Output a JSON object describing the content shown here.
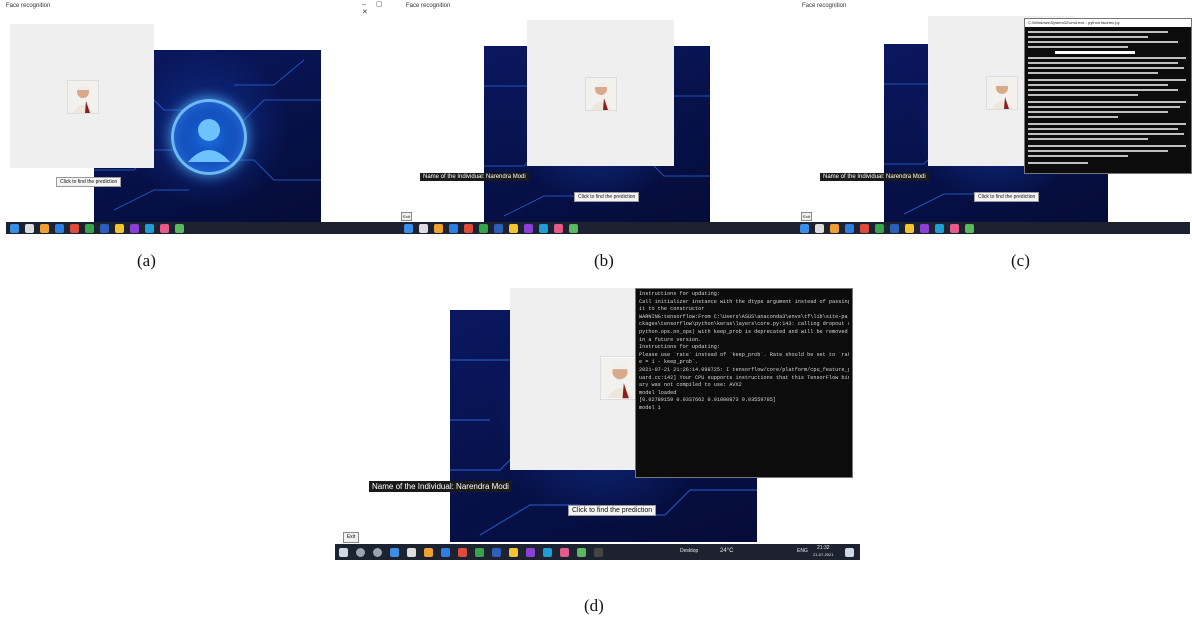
{
  "panels": {
    "a": {
      "caption": "(a)",
      "title": "Face recognition",
      "predict_button": "Click to find the prediction"
    },
    "b": {
      "caption": "(b)",
      "title": "Face recognition",
      "name_label": "Name of the Individual: Narendra Modi",
      "predict_button": "Click to find the prediction",
      "exit_button": "Exit"
    },
    "c": {
      "caption": "(c)",
      "title": "Face recognition",
      "name_label": "Name of the Individual: Narendra Modi",
      "predict_button": "Click to find the prediction",
      "exit_button": "Exit",
      "console_title": "C:\\Windows\\System32\\cmd.exe - python  facerec.py"
    },
    "d": {
      "caption": "(d)",
      "name_label": "Name of the Individual: Narendra Modi",
      "predict_button": "Click to find the prediction",
      "exit_button": "Exit",
      "console_lines": [
        "Instructions for updating:",
        "Call initializer instance with the dtype argument instead of passing",
        " it to the constructor",
        "WARNING:tensorflow:From C:\\Users\\ASUS\\anaconda3\\envs\\tf\\lib\\site-pa",
        "ckages\\tensorflow\\python\\keras\\layers\\core.py:143: calling dropout (from tensorflow.",
        "python.ops.nn_ops) with keep_prob is deprecated and will be removed",
        " in a future version.",
        "Instructions for updating:",
        "Please use `rate` instead of `keep_prob`. Rate should be set to `rat",
        "e = 1 - keep_prob`.",
        "2021-07-21 21:26:14.098725: I tensorflow/core/platform/cpu_feature_g",
        "uard.cc:142] Your CPU supports instructions that this TensorFlow bin",
        "ary was not compiled to use: AVX2",
        "model loaded",
        "[0.02789159  0.0337662   0.01080873  0.03559785]",
        "model 1"
      ],
      "taskbar": {
        "desktop": "Desktop",
        "weather": "24°C",
        "lang": "ENG",
        "time": "21:32",
        "date": "21-07-2021"
      }
    }
  }
}
